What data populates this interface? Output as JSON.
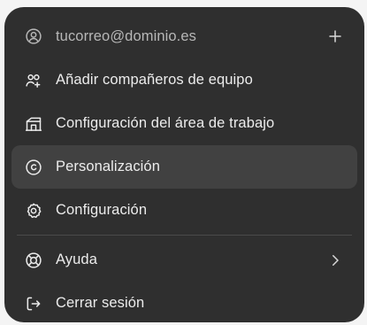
{
  "menu": {
    "account": {
      "email": "tucorreo@dominio.es",
      "icon": "user-circle-icon",
      "add_icon": "plus-icon"
    },
    "items": [
      {
        "id": "add-teammates",
        "label": "Añadir compañeros de equipo",
        "icon": "users-plus-icon"
      },
      {
        "id": "workspace-settings",
        "label": "Configuración del área de trabajo",
        "icon": "building-icon"
      },
      {
        "id": "personalization",
        "label": "Personalización",
        "icon": "personalization-icon",
        "active": true
      },
      {
        "id": "settings",
        "label": "Configuración",
        "icon": "gear-icon"
      }
    ],
    "bottom_items": [
      {
        "id": "help",
        "label": "Ayuda",
        "icon": "lifebuoy-icon",
        "trailing_icon": "chevron-right-icon"
      },
      {
        "id": "logout",
        "label": "Cerrar sesión",
        "icon": "logout-icon"
      }
    ]
  },
  "colors": {
    "menu_bg": "#2f2f2f",
    "active_bg": "#414141",
    "text": "#ececec",
    "muted_text": "#b7b7b7",
    "page_bg": "#f4f4f4"
  }
}
